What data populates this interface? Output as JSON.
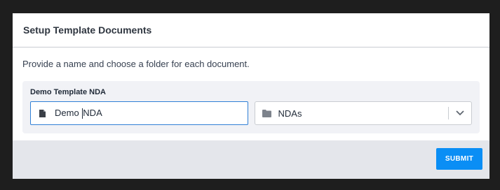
{
  "modal": {
    "title": "Setup Template Documents",
    "instructions": "Provide a name and choose a folder for each document."
  },
  "documents": [
    {
      "label": "Demo Template NDA",
      "name_value_before_cursor": "Demo ",
      "name_value_after_cursor": "NDA",
      "name_icon": "document-icon",
      "folder_icon": "folder-icon",
      "folder_value": "NDAs"
    }
  ],
  "footer": {
    "submit_label": "SUBMIT"
  },
  "colors": {
    "accent": "#0a8ef5",
    "focus_border": "#2f7fd6",
    "footer_bg": "#e4e6eb",
    "card_bg": "#f1f2f6"
  }
}
